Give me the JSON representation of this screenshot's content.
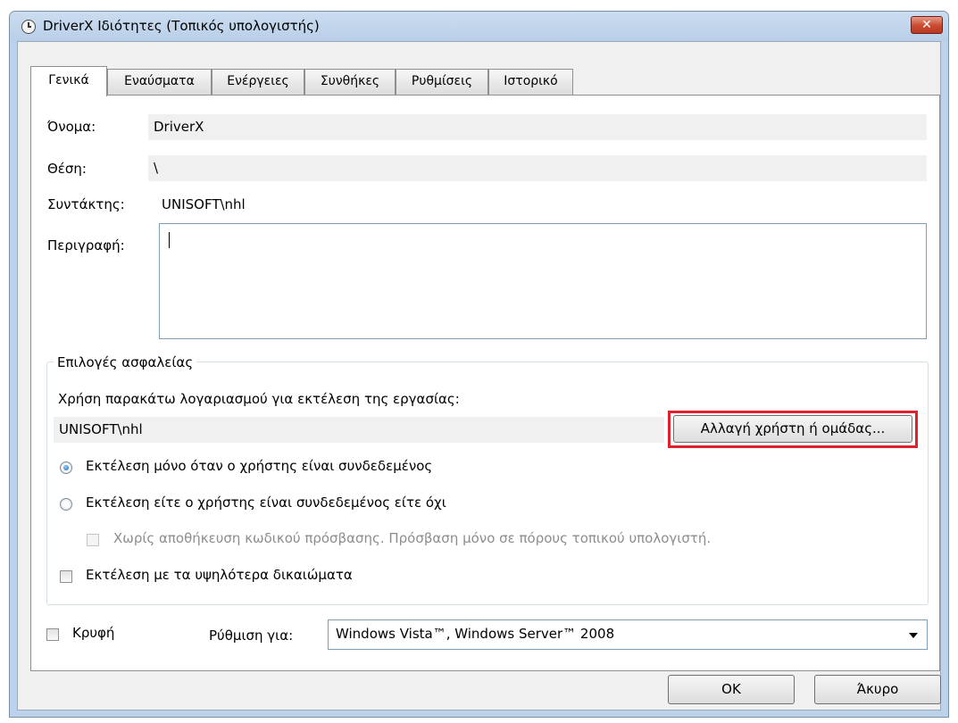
{
  "window": {
    "title": "DriverX Ιδιότητες (Τοπικός υπολογιστής)",
    "close_label": "✕"
  },
  "tabs": [
    "Γενικά",
    "Εναύσματα",
    "Ενέργειες",
    "Συνθήκες",
    "Ρυθμίσεις",
    "Ιστορικό"
  ],
  "general": {
    "name_label": "Όνομα:",
    "name_value": "DriverX",
    "location_label": "Θέση:",
    "location_value": "\\",
    "author_label": "Συντάκτης:",
    "author_value": "UNISOFT\\nhl",
    "description_label": "Περιγραφή:",
    "description_value": ""
  },
  "security": {
    "group_title": "Επιλογές ασφαλείας",
    "account_prompt": "Χρήση παρακάτω λογαριασμού για εκτέλεση της εργασίας:",
    "account_value": "UNISOFT\\nhl",
    "change_user_button": "Αλλαγή χρήστη ή ομάδας...",
    "radio_logged_on": "Εκτέλεση μόνο όταν ο χρήστης είναι συνδεδεμένος",
    "radio_logged_on_selected": true,
    "radio_whether": "Εκτέλεση είτε ο χρήστης είναι συνδεδεμένος είτε όχι",
    "no_store_password": "Χωρίς αποθήκευση κωδικού πρόσβασης. Πρόσβαση μόνο σε πόρους τοπικού υπολογιστή.",
    "highest_privileges": "Εκτέλεση με τα υψηλότερα δικαιώματα"
  },
  "bottom": {
    "hidden_label": "Κρυφή",
    "configure_label": "Ρύθμιση για:",
    "configure_value": "Windows Vista™, Windows Server™ 2008",
    "ok_button": "OK",
    "cancel_button": "Άκυρο"
  },
  "colors": {
    "highlight_border": "#e0202a",
    "title_bar": "#bcd1ea",
    "close_button": "#c94a2e"
  }
}
